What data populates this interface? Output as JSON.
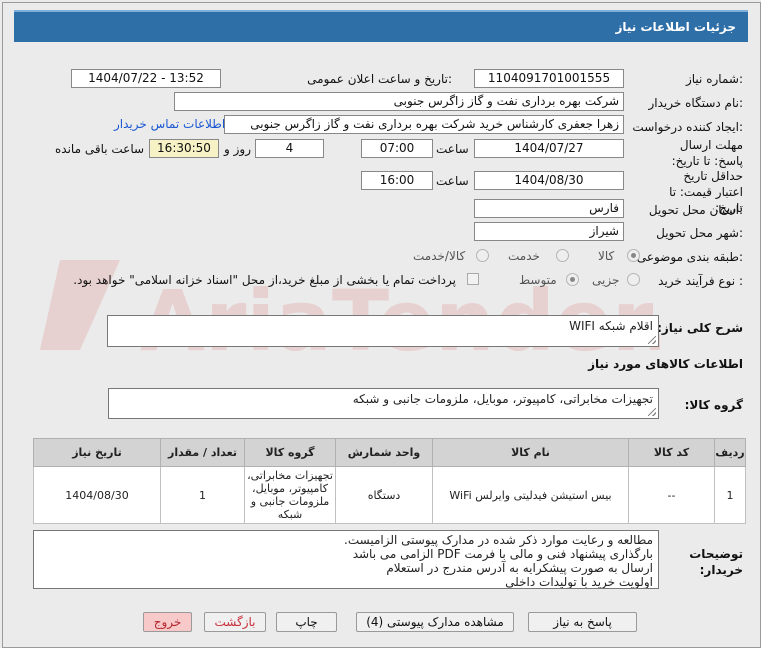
{
  "header": {
    "title": "جزئیات اطلاعات نیاز"
  },
  "fields": {
    "need_number_label": "شماره نیاز:",
    "need_number": "1104091701001555",
    "announce_label": "تاریخ و ساعت اعلان عمومی:",
    "announce_value": "1404/07/22 - 13:52",
    "buyer_label": "نام دستگاه خریدار:",
    "buyer_value": "شرکت بهره برداری نفت و گاز زاگرس جنوبی",
    "creator_label": "ایجاد کننده درخواست:",
    "creator_value": "زهرا جعفری کارشناس خرید شرکت بهره برداری نفت و گاز زاگرس جنوبی",
    "contact_link": "اطلاعات تماس خریدار",
    "deadline_label": "مهلت ارسال پاسخ: تا تاریخ:",
    "deadline_date": "1404/07/27",
    "time_label": "ساعت",
    "deadline_time": "07:00",
    "days_value": "4",
    "days_label": "روز و",
    "remaining_value": "16:30:50",
    "remaining_label": "ساعت باقی مانده",
    "validity_label": "حداقل تاریخ اعتبار قیمت: تا تاریخ:",
    "validity_date": "1404/08/30",
    "validity_time": "16:00",
    "province_label": "استان محل تحویل:",
    "province_value": "فارس",
    "city_label": "شهر محل تحویل:",
    "city_value": "شیراز",
    "category_label": "طبقه بندی موضوعی:",
    "category_options": [
      "کالا",
      "خدمت",
      "کالا/خدمت"
    ],
    "process_label": "نوع فرآیند خرید :",
    "process_options": [
      "جزیی",
      "متوسط"
    ],
    "payment_note": "پرداخت تمام یا بخشی از مبلغ خرید،از محل \"اسناد خزانه اسلامی\" خواهد بود."
  },
  "summary": {
    "label": "شرح کلی نیاز:",
    "value": "اقلام شبکه WIFI"
  },
  "goods_section_title": "اطلاعات کالاهای مورد نیاز",
  "goods_group": {
    "label": "گروه کالا:",
    "value": "تجهیزات مخابراتی، کامپیوتر، موبایل، ملزومات جانبی و شبکه"
  },
  "table": {
    "headers": [
      "ردیف",
      "کد کالا",
      "نام کالا",
      "واحد شمارش",
      "گروه کالا",
      "تعداد / مقدار",
      "تاریخ نیاز"
    ],
    "rows": [
      [
        "1",
        "--",
        "بیس استیشن فیدلیتی وایرلس WiFi",
        "دستگاه",
        "تجهیزات مخابراتی، کامپیوتر، موبایل، ملزومات جانبی و شبکه",
        "1",
        "1404/08/30"
      ]
    ]
  },
  "notes": {
    "label": "توضیحات خریدار:",
    "lines": [
      "مطالعه و رعایت موارد ذکر شده در مدارک پیوستی الزامیست.",
      "بارگذاری پیشنهاد فنی و مالی با فرمت PDF الزامی می باشد",
      "ارسال به صورت پیشکرایه به آدرس مندرج در استعلام",
      "اولویت خرید با تولیدات داخلی"
    ]
  },
  "buttons": {
    "reply": "پاسخ به نیاز",
    "docs": "مشاهده مدارک پیوستی (4)",
    "print": "چاپ",
    "back": "بازگشت",
    "exit": "خروج"
  },
  "watermark_text": "AriaTender.neT",
  "colors": {
    "header": "#2f6fa7",
    "link": "#1a58d2",
    "highlight": "#f7f1c6",
    "exit_button": "#f7c9c9"
  }
}
